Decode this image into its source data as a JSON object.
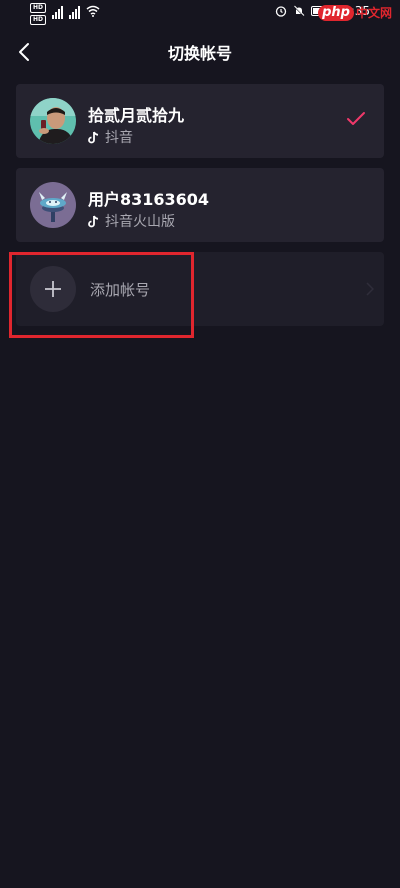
{
  "status_bar": {
    "hd_1": "HD",
    "hd_2": "HD",
    "net_1": "4G",
    "net_2": "4G",
    "time": "14:35"
  },
  "watermark": {
    "logo": "php",
    "text": "中文网"
  },
  "header": {
    "title": "切换帐号"
  },
  "accounts": [
    {
      "name": "拾贰月贰拾九",
      "app": "抖音",
      "selected": true
    },
    {
      "name": "用户83163604",
      "app": "抖音火山版",
      "selected": false
    }
  ],
  "add_account": {
    "label": "添加帐号"
  },
  "colors": {
    "background": "#16151f",
    "card": "#25232f",
    "check": "#f0386a",
    "highlight": "#e0262e"
  }
}
